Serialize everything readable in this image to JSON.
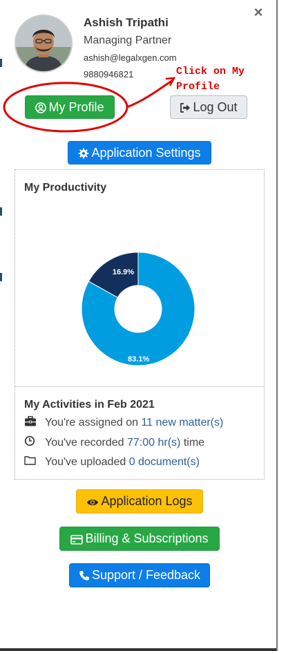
{
  "header": {
    "close_symbol": "×",
    "user": {
      "name": "Ashish Tripathi",
      "role": "Managing Partner",
      "email": "ashish@legalxgen.com",
      "phone": "9880946821"
    }
  },
  "annotation": {
    "text_line1": "Click on My",
    "text_line2": "Profile",
    "color": "#e00000"
  },
  "buttons": {
    "my_profile": "My Profile",
    "log_out": "Log Out",
    "application_settings": "Application Settings",
    "application_logs": "Application Logs",
    "billing_subscriptions": "Billing & Subscriptions",
    "support_feedback": "Support / Feedback"
  },
  "productivity": {
    "title": "My Productivity",
    "chart_data": {
      "type": "pie",
      "categories": [
        "",
        ""
      ],
      "values": [
        83.1,
        16.9
      ],
      "data_labels": [
        "83.1%",
        "16.9%"
      ],
      "colors": [
        "#009ee0",
        "#13305c"
      ]
    }
  },
  "activities": {
    "title": "My Activities in Feb 2021",
    "items": [
      {
        "icon": "briefcase-icon",
        "prefix": "You're assigned on ",
        "link": "11 new matter(s)",
        "suffix": ""
      },
      {
        "icon": "clock-icon",
        "prefix": "You've recorded ",
        "link": "77:00 hr(s)",
        "suffix": " time"
      },
      {
        "icon": "folder-icon",
        "prefix": "You've uploaded ",
        "link": "0 document(s)",
        "suffix": ""
      }
    ]
  },
  "colors": {
    "green": "#28a745",
    "blue": "#0d7de8",
    "yellow": "#ffc107",
    "link": "#2e5c99"
  }
}
